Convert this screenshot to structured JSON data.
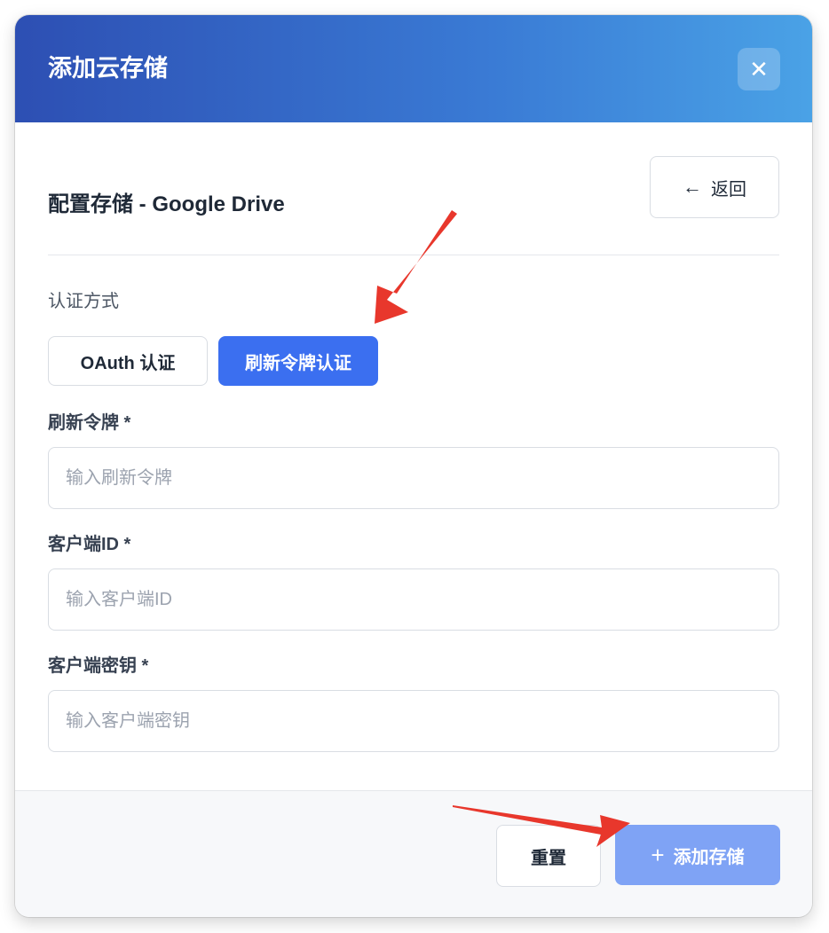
{
  "modal": {
    "title": "添加云存储",
    "close_label": "✕"
  },
  "config": {
    "title": "配置存储 - Google Drive",
    "back_label": "返回"
  },
  "auth": {
    "label": "认证方式",
    "tabs": [
      {
        "label": "OAuth 认证",
        "active": false
      },
      {
        "label": "刷新令牌认证",
        "active": true
      }
    ]
  },
  "fields": [
    {
      "label": "刷新令牌 *",
      "placeholder": "输入刷新令牌",
      "value": ""
    },
    {
      "label": "客户端ID *",
      "placeholder": "输入客户端ID",
      "value": ""
    },
    {
      "label": "客户端密钥 *",
      "placeholder": "输入客户端密钥",
      "value": ""
    }
  ],
  "footer": {
    "reset_label": "重置",
    "add_label": "添加存储"
  },
  "colors": {
    "header_gradient_start": "#2d4fb3",
    "header_gradient_end": "#4aa2e6",
    "active_tab": "#3b6ff0",
    "add_button_disabled": "#7fa3f5",
    "annotation_arrow": "#e8372c"
  },
  "icons": {
    "close": "close-icon",
    "back": "arrow-left-icon",
    "add": "plus-icon"
  }
}
